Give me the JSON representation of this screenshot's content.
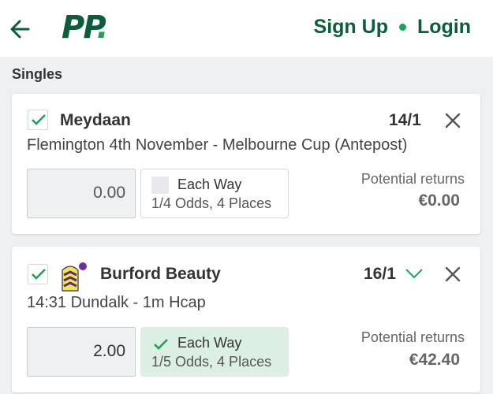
{
  "header": {
    "logo": "PP",
    "logo_dot": ".",
    "signup": "Sign Up",
    "login": "Login",
    "back_icon": "arrow-left-icon"
  },
  "section": {
    "title": "Singles"
  },
  "bets": [
    {
      "selection": "Meydaan",
      "odds": "14/1",
      "event": "Flemington 4th November - Melbourne Cup (Antepost)",
      "stake": "0.00",
      "each_way_label": "Each Way",
      "each_way_terms": "1/4 Odds, 4 Places",
      "each_way_checked": false,
      "returns_label": "Potential returns",
      "returns": "€0.00",
      "selected": true
    },
    {
      "selection": "Burford Beauty",
      "odds": "16/1",
      "event": "14:31 Dundalk - 1m Hcap",
      "stake": "2.00",
      "each_way_label": "Each Way",
      "each_way_terms": "1/5 Odds, 4 Places",
      "each_way_checked": true,
      "returns_label": "Potential returns",
      "returns": "€42.40",
      "selected": true
    }
  ],
  "colors": {
    "brand_green": "#0b5e3a",
    "accent_green": "#18a55a",
    "each_way_on_bg": "#dcefe3"
  }
}
